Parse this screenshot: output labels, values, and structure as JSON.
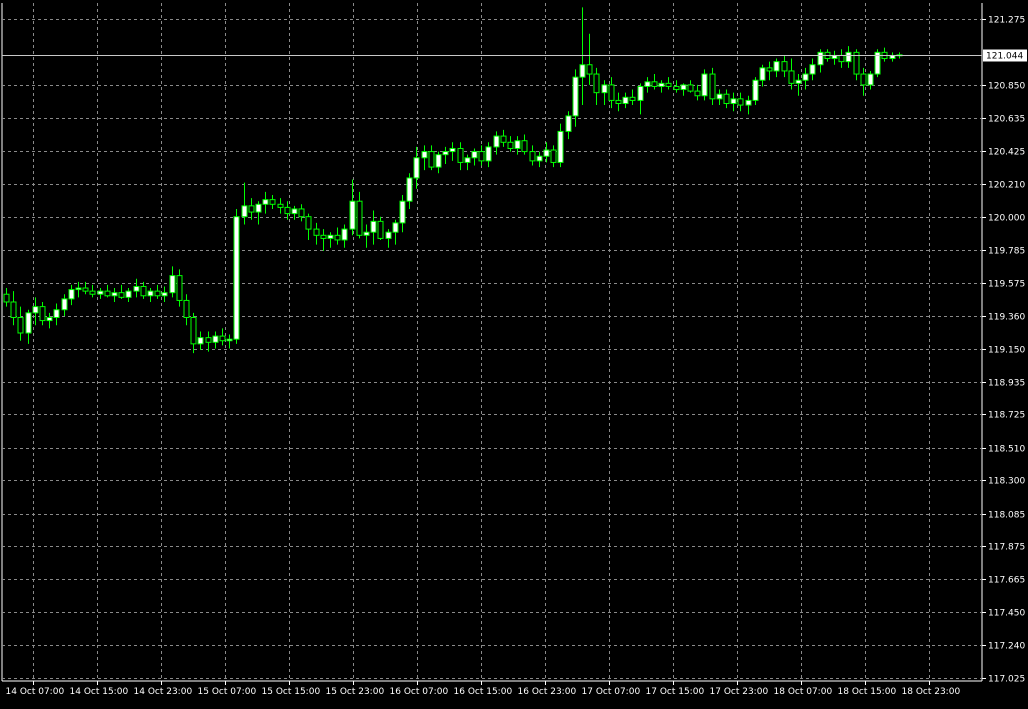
{
  "chart_data": {
    "type": "candlestick",
    "title": "",
    "xlabel": "",
    "ylabel": "",
    "ylim": [
      117.025,
      121.35
    ],
    "grid": true,
    "colors": {
      "background": "#000000",
      "grid": "#8a8a8a",
      "candle": "#00ff00",
      "bull_body": "#ffffff",
      "bear_body": "#000000",
      "axis": "#ffffff",
      "price_line": "#c8c8c8"
    },
    "y_ticks": [
      "121.275",
      "120.850",
      "120.635",
      "120.425",
      "120.210",
      "120.000",
      "119.785",
      "119.575",
      "119.360",
      "119.150",
      "118.935",
      "118.725",
      "118.510",
      "118.300",
      "118.085",
      "117.875",
      "117.665",
      "117.450",
      "117.240",
      "117.025"
    ],
    "x_ticks": [
      "14 Oct 07:00",
      "14 Oct 15:00",
      "14 Oct 23:00",
      "15 Oct 07:00",
      "15 Oct 15:00",
      "15 Oct 23:00",
      "16 Oct 07:00",
      "16 Oct 15:00",
      "16 Oct 23:00",
      "17 Oct 07:00",
      "17 Oct 15:00",
      "17 Oct 23:00",
      "18 Oct 07:00",
      "18 Oct 15:00",
      "18 Oct 23:00"
    ],
    "current_price": "121.044",
    "candles": [
      [
        119.5,
        119.54,
        119.42,
        119.45
      ],
      [
        119.45,
        119.52,
        119.3,
        119.35
      ],
      [
        119.35,
        119.42,
        119.2,
        119.25
      ],
      [
        119.25,
        119.4,
        119.18,
        119.38
      ],
      [
        119.38,
        119.48,
        119.3,
        119.42
      ],
      [
        119.42,
        119.45,
        119.3,
        119.33
      ],
      [
        119.33,
        119.38,
        119.28,
        119.35
      ],
      [
        119.35,
        119.44,
        119.3,
        119.4
      ],
      [
        119.4,
        119.5,
        119.36,
        119.47
      ],
      [
        119.47,
        119.56,
        119.43,
        119.53
      ],
      [
        119.53,
        119.58,
        119.48,
        119.54
      ],
      [
        119.54,
        119.58,
        119.5,
        119.52
      ],
      [
        119.52,
        119.56,
        119.48,
        119.5
      ],
      [
        119.5,
        119.54,
        119.47,
        119.52
      ],
      [
        119.52,
        119.56,
        119.48,
        119.49
      ],
      [
        119.49,
        119.54,
        119.45,
        119.51
      ],
      [
        119.51,
        119.56,
        119.47,
        119.48
      ],
      [
        119.48,
        119.54,
        119.45,
        119.52
      ],
      [
        119.52,
        119.6,
        119.48,
        119.55
      ],
      [
        119.55,
        119.58,
        119.47,
        119.49
      ],
      [
        119.49,
        119.54,
        119.45,
        119.52
      ],
      [
        119.52,
        119.56,
        119.47,
        119.49
      ],
      [
        119.49,
        119.55,
        119.45,
        119.51
      ],
      [
        119.51,
        119.68,
        119.48,
        119.62
      ],
      [
        119.62,
        119.66,
        119.42,
        119.46
      ],
      [
        119.46,
        119.5,
        119.3,
        119.35
      ],
      [
        119.35,
        119.38,
        119.12,
        119.18
      ],
      [
        119.18,
        119.26,
        119.14,
        119.22
      ],
      [
        119.22,
        119.26,
        119.13,
        119.19
      ],
      [
        119.19,
        119.26,
        119.15,
        119.23
      ],
      [
        119.23,
        119.28,
        119.17,
        119.2
      ],
      [
        119.2,
        119.24,
        119.15,
        119.21
      ],
      [
        119.21,
        120.05,
        119.18,
        120.0
      ],
      [
        120.0,
        120.22,
        119.95,
        120.07
      ],
      [
        120.07,
        120.12,
        119.98,
        120.03
      ],
      [
        120.03,
        120.1,
        119.95,
        120.08
      ],
      [
        120.08,
        120.16,
        120.02,
        120.11
      ],
      [
        120.11,
        120.14,
        120.05,
        120.08
      ],
      [
        120.08,
        120.12,
        120.02,
        120.06
      ],
      [
        120.06,
        120.1,
        119.98,
        120.02
      ],
      [
        120.02,
        120.07,
        119.98,
        120.05
      ],
      [
        120.05,
        120.08,
        119.97,
        120.0
      ],
      [
        120.0,
        120.02,
        119.85,
        119.92
      ],
      [
        119.92,
        119.96,
        119.82,
        119.88
      ],
      [
        119.88,
        119.92,
        119.78,
        119.86
      ],
      [
        119.86,
        119.9,
        119.8,
        119.88
      ],
      [
        119.88,
        119.93,
        119.82,
        119.85
      ],
      [
        119.85,
        119.95,
        119.8,
        119.92
      ],
      [
        119.92,
        120.24,
        119.88,
        120.1
      ],
      [
        120.1,
        120.16,
        119.86,
        119.88
      ],
      [
        119.88,
        119.95,
        119.8,
        119.9
      ],
      [
        119.9,
        120.04,
        119.82,
        119.97
      ],
      [
        119.97,
        120.0,
        119.85,
        119.86
      ],
      [
        119.86,
        119.92,
        119.8,
        119.9
      ],
      [
        119.9,
        119.98,
        119.82,
        119.96
      ],
      [
        119.96,
        120.14,
        119.9,
        120.1
      ],
      [
        120.1,
        120.28,
        120.05,
        120.25
      ],
      [
        120.25,
        120.45,
        120.18,
        120.38
      ],
      [
        120.38,
        120.46,
        120.3,
        120.42
      ],
      [
        120.42,
        120.46,
        120.3,
        120.32
      ],
      [
        120.32,
        120.42,
        120.28,
        120.4
      ],
      [
        120.4,
        120.45,
        120.34,
        120.42
      ],
      [
        120.42,
        120.48,
        120.36,
        120.44
      ],
      [
        120.44,
        120.48,
        120.3,
        120.35
      ],
      [
        120.35,
        120.4,
        120.3,
        120.38
      ],
      [
        120.38,
        120.44,
        120.33,
        120.42
      ],
      [
        120.42,
        120.46,
        120.33,
        120.36
      ],
      [
        120.36,
        120.48,
        120.32,
        120.45
      ],
      [
        120.45,
        120.55,
        120.4,
        120.52
      ],
      [
        120.52,
        120.56,
        120.45,
        120.48
      ],
      [
        120.48,
        120.52,
        120.42,
        120.44
      ],
      [
        120.44,
        120.52,
        120.4,
        120.49
      ],
      [
        120.49,
        120.53,
        120.4,
        120.42
      ],
      [
        120.42,
        120.46,
        120.33,
        120.36
      ],
      [
        120.36,
        120.42,
        120.32,
        120.39
      ],
      [
        120.39,
        120.48,
        120.35,
        120.43
      ],
      [
        120.43,
        120.46,
        120.32,
        120.35
      ],
      [
        120.35,
        120.6,
        120.32,
        120.55
      ],
      [
        120.55,
        120.68,
        120.5,
        120.65
      ],
      [
        120.65,
        120.95,
        120.58,
        120.9
      ],
      [
        120.9,
        121.35,
        120.72,
        120.98
      ],
      [
        120.98,
        121.18,
        120.85,
        120.92
      ],
      [
        120.92,
        120.96,
        120.72,
        120.8
      ],
      [
        120.8,
        120.88,
        120.72,
        120.85
      ],
      [
        120.85,
        120.9,
        120.7,
        120.75
      ],
      [
        120.75,
        120.8,
        120.68,
        120.73
      ],
      [
        120.73,
        120.8,
        120.7,
        120.77
      ],
      [
        120.77,
        120.82,
        120.72,
        120.75
      ],
      [
        120.75,
        120.86,
        120.66,
        120.84
      ],
      [
        120.84,
        120.9,
        120.8,
        120.87
      ],
      [
        120.87,
        120.92,
        120.82,
        120.84
      ],
      [
        120.84,
        120.88,
        120.8,
        120.86
      ],
      [
        120.86,
        120.9,
        120.82,
        120.84
      ],
      [
        120.84,
        120.88,
        120.8,
        120.82
      ],
      [
        120.82,
        120.86,
        120.78,
        120.85
      ],
      [
        120.85,
        120.88,
        120.8,
        120.81
      ],
      [
        120.81,
        120.85,
        120.75,
        120.78
      ],
      [
        120.78,
        120.95,
        120.75,
        120.92
      ],
      [
        120.92,
        120.96,
        120.72,
        120.76
      ],
      [
        120.76,
        120.82,
        120.72,
        120.79
      ],
      [
        120.79,
        120.82,
        120.7,
        120.73
      ],
      [
        120.73,
        120.8,
        120.68,
        120.76
      ],
      [
        120.76,
        120.8,
        120.68,
        120.72
      ],
      [
        120.72,
        120.78,
        120.66,
        120.75
      ],
      [
        120.75,
        120.9,
        120.72,
        120.88
      ],
      [
        120.88,
        120.98,
        120.84,
        120.96
      ],
      [
        120.96,
        121.0,
        120.88,
        120.94
      ],
      [
        120.94,
        121.02,
        120.9,
        121.0
      ],
      [
        121.0,
        121.04,
        120.9,
        120.94
      ],
      [
        120.94,
        121.02,
        120.82,
        120.86
      ],
      [
        120.86,
        120.92,
        120.78,
        120.88
      ],
      [
        120.88,
        120.96,
        120.82,
        120.92
      ],
      [
        120.92,
        121.02,
        120.88,
        120.98
      ],
      [
        120.98,
        121.08,
        120.93,
        121.06
      ],
      [
        121.06,
        121.08,
        121.0,
        121.02
      ],
      [
        121.02,
        121.07,
        120.98,
        121.04
      ],
      [
        121.04,
        121.08,
        120.96,
        121.0
      ],
      [
        121.0,
        121.1,
        120.96,
        121.06
      ],
      [
        121.06,
        121.08,
        120.88,
        120.92
      ],
      [
        120.92,
        120.96,
        120.78,
        120.85
      ],
      [
        120.85,
        120.94,
        120.82,
        120.92
      ],
      [
        120.92,
        121.08,
        120.9,
        121.06
      ],
      [
        121.06,
        121.09,
        121.0,
        121.02
      ],
      [
        121.02,
        121.06,
        121.0,
        121.04
      ],
      [
        121.04,
        121.06,
        121.02,
        121.044
      ]
    ]
  }
}
